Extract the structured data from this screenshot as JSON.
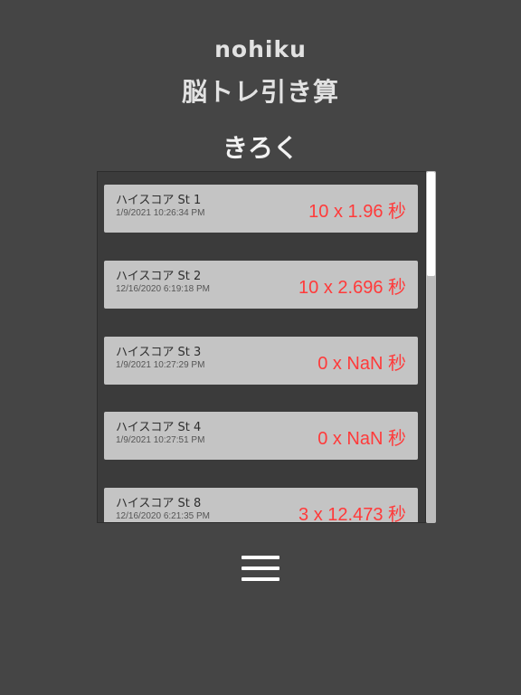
{
  "header": {
    "brand": "nohiku",
    "app_title": "脳トレ引き算",
    "section_title": "きろく"
  },
  "records": [
    {
      "name": "ハイスコア St 1",
      "date": "1/9/2021 10:26:34 PM",
      "score": "10 x 1.96 秒"
    },
    {
      "name": "ハイスコア St 2",
      "date": "12/16/2020 6:19:18 PM",
      "score": "10 x 2.696 秒"
    },
    {
      "name": "ハイスコア St 3",
      "date": "1/9/2021 10:27:29 PM",
      "score": "0 x NaN 秒"
    },
    {
      "name": "ハイスコア St 4",
      "date": "1/9/2021 10:27:51 PM",
      "score": "0 x NaN 秒"
    },
    {
      "name": "ハイスコア St 8",
      "date": "12/16/2020 6:21:35 PM",
      "score": "3 x 12.473 秒"
    }
  ],
  "scrollbar": {
    "position_fraction": 0.0
  },
  "icons": {
    "menu": "hamburger-menu-icon"
  },
  "colors": {
    "background": "#454545",
    "row_background": "#c4c4c4",
    "score_text": "#ff3a3a"
  }
}
